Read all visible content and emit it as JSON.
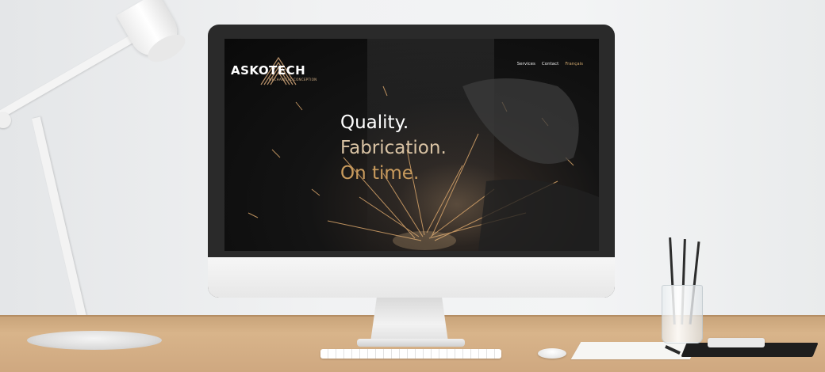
{
  "site": {
    "logo_text": "ASKOTECH",
    "logo_subtitle": "MECHANICAL CONCEPTION",
    "nav": {
      "services": "Services",
      "contact": "Contact",
      "language": "Français"
    },
    "hero": {
      "line1": "Quality.",
      "line2": "Fabrication.",
      "line3": "On time."
    }
  },
  "colors": {
    "accent_gold": "#c99b5d",
    "accent_light": "#d9c3a4",
    "screen_bg": "#0a0a0a"
  },
  "icons": {
    "logo_mark": "mountain-lines-logo-icon"
  }
}
